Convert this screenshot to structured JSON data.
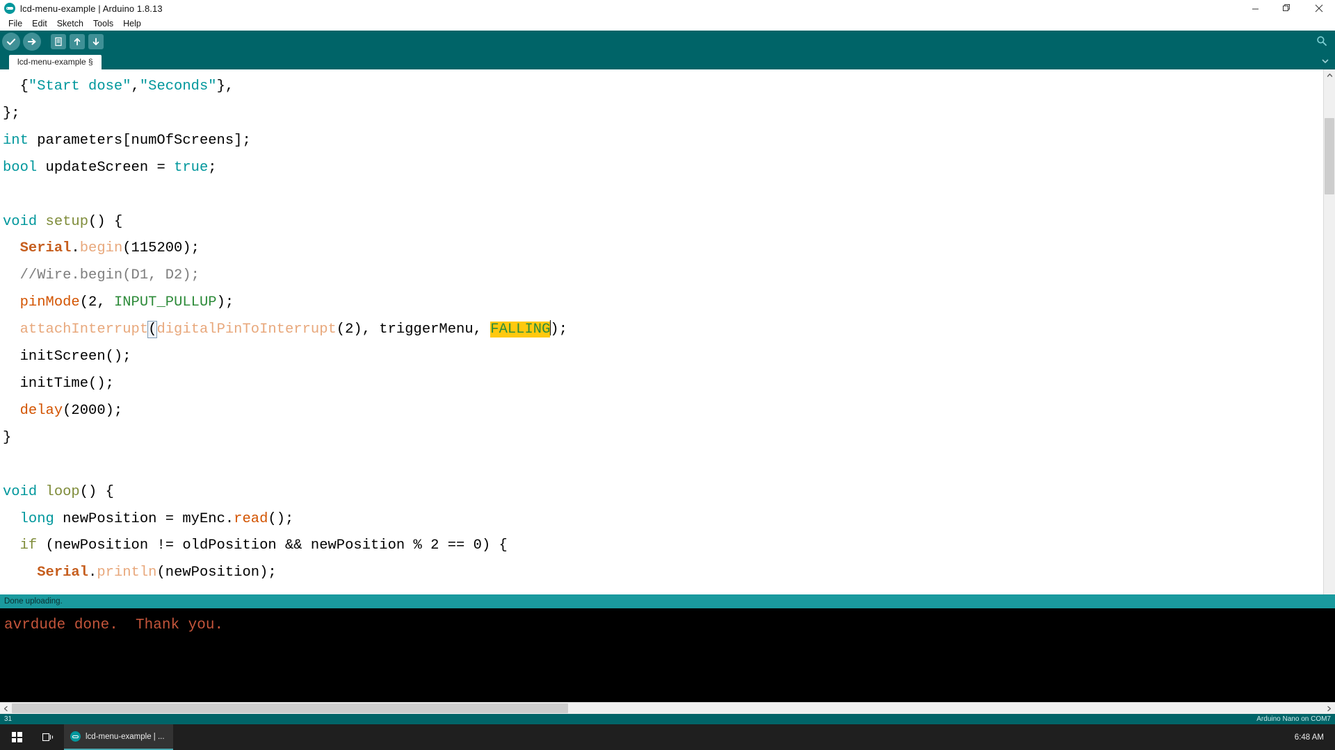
{
  "window": {
    "title": "lcd-menu-example | Arduino 1.8.13",
    "app_icon": "arduino-logo-icon",
    "minimize_label": "Minimize",
    "maximize_label": "Restore",
    "close_label": "Close"
  },
  "menubar": {
    "items": [
      {
        "label": "File"
      },
      {
        "label": "Edit"
      },
      {
        "label": "Sketch"
      },
      {
        "label": "Tools"
      },
      {
        "label": "Help"
      }
    ]
  },
  "toolbar": {
    "verify_label": "Verify",
    "upload_label": "Upload",
    "new_label": "New",
    "open_label": "Open",
    "save_label": "Save",
    "serial_monitor_label": "Serial Monitor"
  },
  "tabs": {
    "items": [
      {
        "label": "lcd-menu-example §",
        "active": true
      }
    ],
    "menu_label": "Tab menu"
  },
  "editor": {
    "lines": [
      {
        "n": 1,
        "tokens": [
          {
            "t": "  {",
            "c": "plain"
          },
          {
            "t": "\"Start dose\"",
            "c": "str"
          },
          {
            "t": ",",
            "c": "plain"
          },
          {
            "t": "\"Seconds\"",
            "c": "str"
          },
          {
            "t": "},",
            "c": "plain"
          }
        ]
      },
      {
        "n": 2,
        "tokens": [
          {
            "t": "};",
            "c": "plain"
          }
        ]
      },
      {
        "n": 3,
        "tokens": [
          {
            "t": "int",
            "c": "kw"
          },
          {
            "t": " parameters[numOfScreens];",
            "c": "plain"
          }
        ]
      },
      {
        "n": 4,
        "tokens": [
          {
            "t": "bool",
            "c": "kw"
          },
          {
            "t": " updateScreen = ",
            "c": "plain"
          },
          {
            "t": "true",
            "c": "kw"
          },
          {
            "t": ";",
            "c": "plain"
          }
        ]
      },
      {
        "n": 5,
        "tokens": [
          {
            "t": "",
            "c": "plain"
          }
        ]
      },
      {
        "n": 6,
        "tokens": [
          {
            "t": "void",
            "c": "kw"
          },
          {
            "t": " ",
            "c": "plain"
          },
          {
            "t": "setup",
            "c": "def"
          },
          {
            "t": "() {",
            "c": "plain"
          }
        ]
      },
      {
        "n": 7,
        "tokens": [
          {
            "t": "  ",
            "c": "plain"
          },
          {
            "t": "Serial",
            "c": "bold"
          },
          {
            "t": ".",
            "c": "plain"
          },
          {
            "t": "begin",
            "c": "fn2"
          },
          {
            "t": "(115200);",
            "c": "plain"
          }
        ]
      },
      {
        "n": 8,
        "tokens": [
          {
            "t": "  //Wire.begin(D1, D2);",
            "c": "cmt"
          }
        ]
      },
      {
        "n": 9,
        "tokens": [
          {
            "t": "  ",
            "c": "plain"
          },
          {
            "t": "pinMode",
            "c": "fn"
          },
          {
            "t": "(2, ",
            "c": "plain"
          },
          {
            "t": "INPUT_PULLUP",
            "c": "const"
          },
          {
            "t": ");",
            "c": "plain"
          }
        ]
      },
      {
        "n": 10,
        "tokens": [
          {
            "t": "  ",
            "c": "plain"
          },
          {
            "t": "attachInterrupt",
            "c": "fn2"
          },
          {
            "t": "(",
            "c": "brkt"
          },
          {
            "t": "digitalPinToInterrupt",
            "c": "fn2"
          },
          {
            "t": "(2), triggerM",
            "c": "plain"
          },
          {
            "t": "е",
            "c": "plain"
          },
          {
            "t": "nu, ",
            "c": "plain"
          },
          {
            "t": "FALLING",
            "c": "sel"
          },
          {
            "t": "│",
            "c": "caretmark"
          },
          {
            "t": ");",
            "c": "plain"
          }
        ]
      },
      {
        "n": 11,
        "tokens": [
          {
            "t": "  initScreen();",
            "c": "plain"
          }
        ]
      },
      {
        "n": 12,
        "tokens": [
          {
            "t": "  initTime();",
            "c": "plain"
          }
        ]
      },
      {
        "n": 13,
        "tokens": [
          {
            "t": "  ",
            "c": "plain"
          },
          {
            "t": "delay",
            "c": "fn"
          },
          {
            "t": "(2000);",
            "c": "plain"
          }
        ]
      },
      {
        "n": 14,
        "tokens": [
          {
            "t": "}",
            "c": "plain"
          }
        ]
      },
      {
        "n": 15,
        "tokens": [
          {
            "t": "",
            "c": "plain"
          }
        ]
      },
      {
        "n": 16,
        "tokens": [
          {
            "t": "void",
            "c": "kw"
          },
          {
            "t": " ",
            "c": "plain"
          },
          {
            "t": "loop",
            "c": "def"
          },
          {
            "t": "() {",
            "c": "plain"
          }
        ]
      },
      {
        "n": 17,
        "tokens": [
          {
            "t": "  ",
            "c": "plain"
          },
          {
            "t": "long",
            "c": "kw"
          },
          {
            "t": " newPosition = myEnc.",
            "c": "plain"
          },
          {
            "t": "read",
            "c": "fn"
          },
          {
            "t": "();",
            "c": "plain"
          }
        ]
      },
      {
        "n": 18,
        "tokens": [
          {
            "t": "  ",
            "c": "plain"
          },
          {
            "t": "if",
            "c": "def"
          },
          {
            "t": " (newPosition != oldPosition ",
            "c": "plain"
          },
          {
            "t": "&&",
            "c": "plain"
          },
          {
            "t": " newPosition ",
            "c": "plain"
          },
          {
            "t": "%",
            "c": "plain"
          },
          {
            "t": " 2 == 0) {",
            "c": "plain"
          }
        ]
      },
      {
        "n": 19,
        "tokens": [
          {
            "t": "    ",
            "c": "plain"
          },
          {
            "t": "Serial",
            "c": "bold"
          },
          {
            "t": ".",
            "c": "plain"
          },
          {
            "t": "println",
            "c": "fn2"
          },
          {
            "t": "(newPosition);",
            "c": "plain"
          }
        ]
      }
    ],
    "selection_text": "FALLING",
    "selection_bg": "#FFC90E"
  },
  "status": {
    "message": "Done uploading.",
    "bar_color": "#1A9A9E"
  },
  "console": {
    "lines": [
      "avrdude done.  Thank you."
    ],
    "text_color": "#C4553B",
    "bg_color": "#000000"
  },
  "bottombar": {
    "line_number": "31",
    "board_info": "Arduino Nano on COM7"
  },
  "taskbar": {
    "start_label": "Start",
    "taskview_label": "Task View",
    "apps": [
      {
        "label": "lcd-menu-example | ...",
        "icon": "arduino-logo-icon",
        "active": true
      }
    ],
    "clock": "6:48 AM"
  },
  "theme": {
    "toolbar_bg": "#006468",
    "accent": "#00979C",
    "tab_active_bg": "#FFFFFF"
  }
}
